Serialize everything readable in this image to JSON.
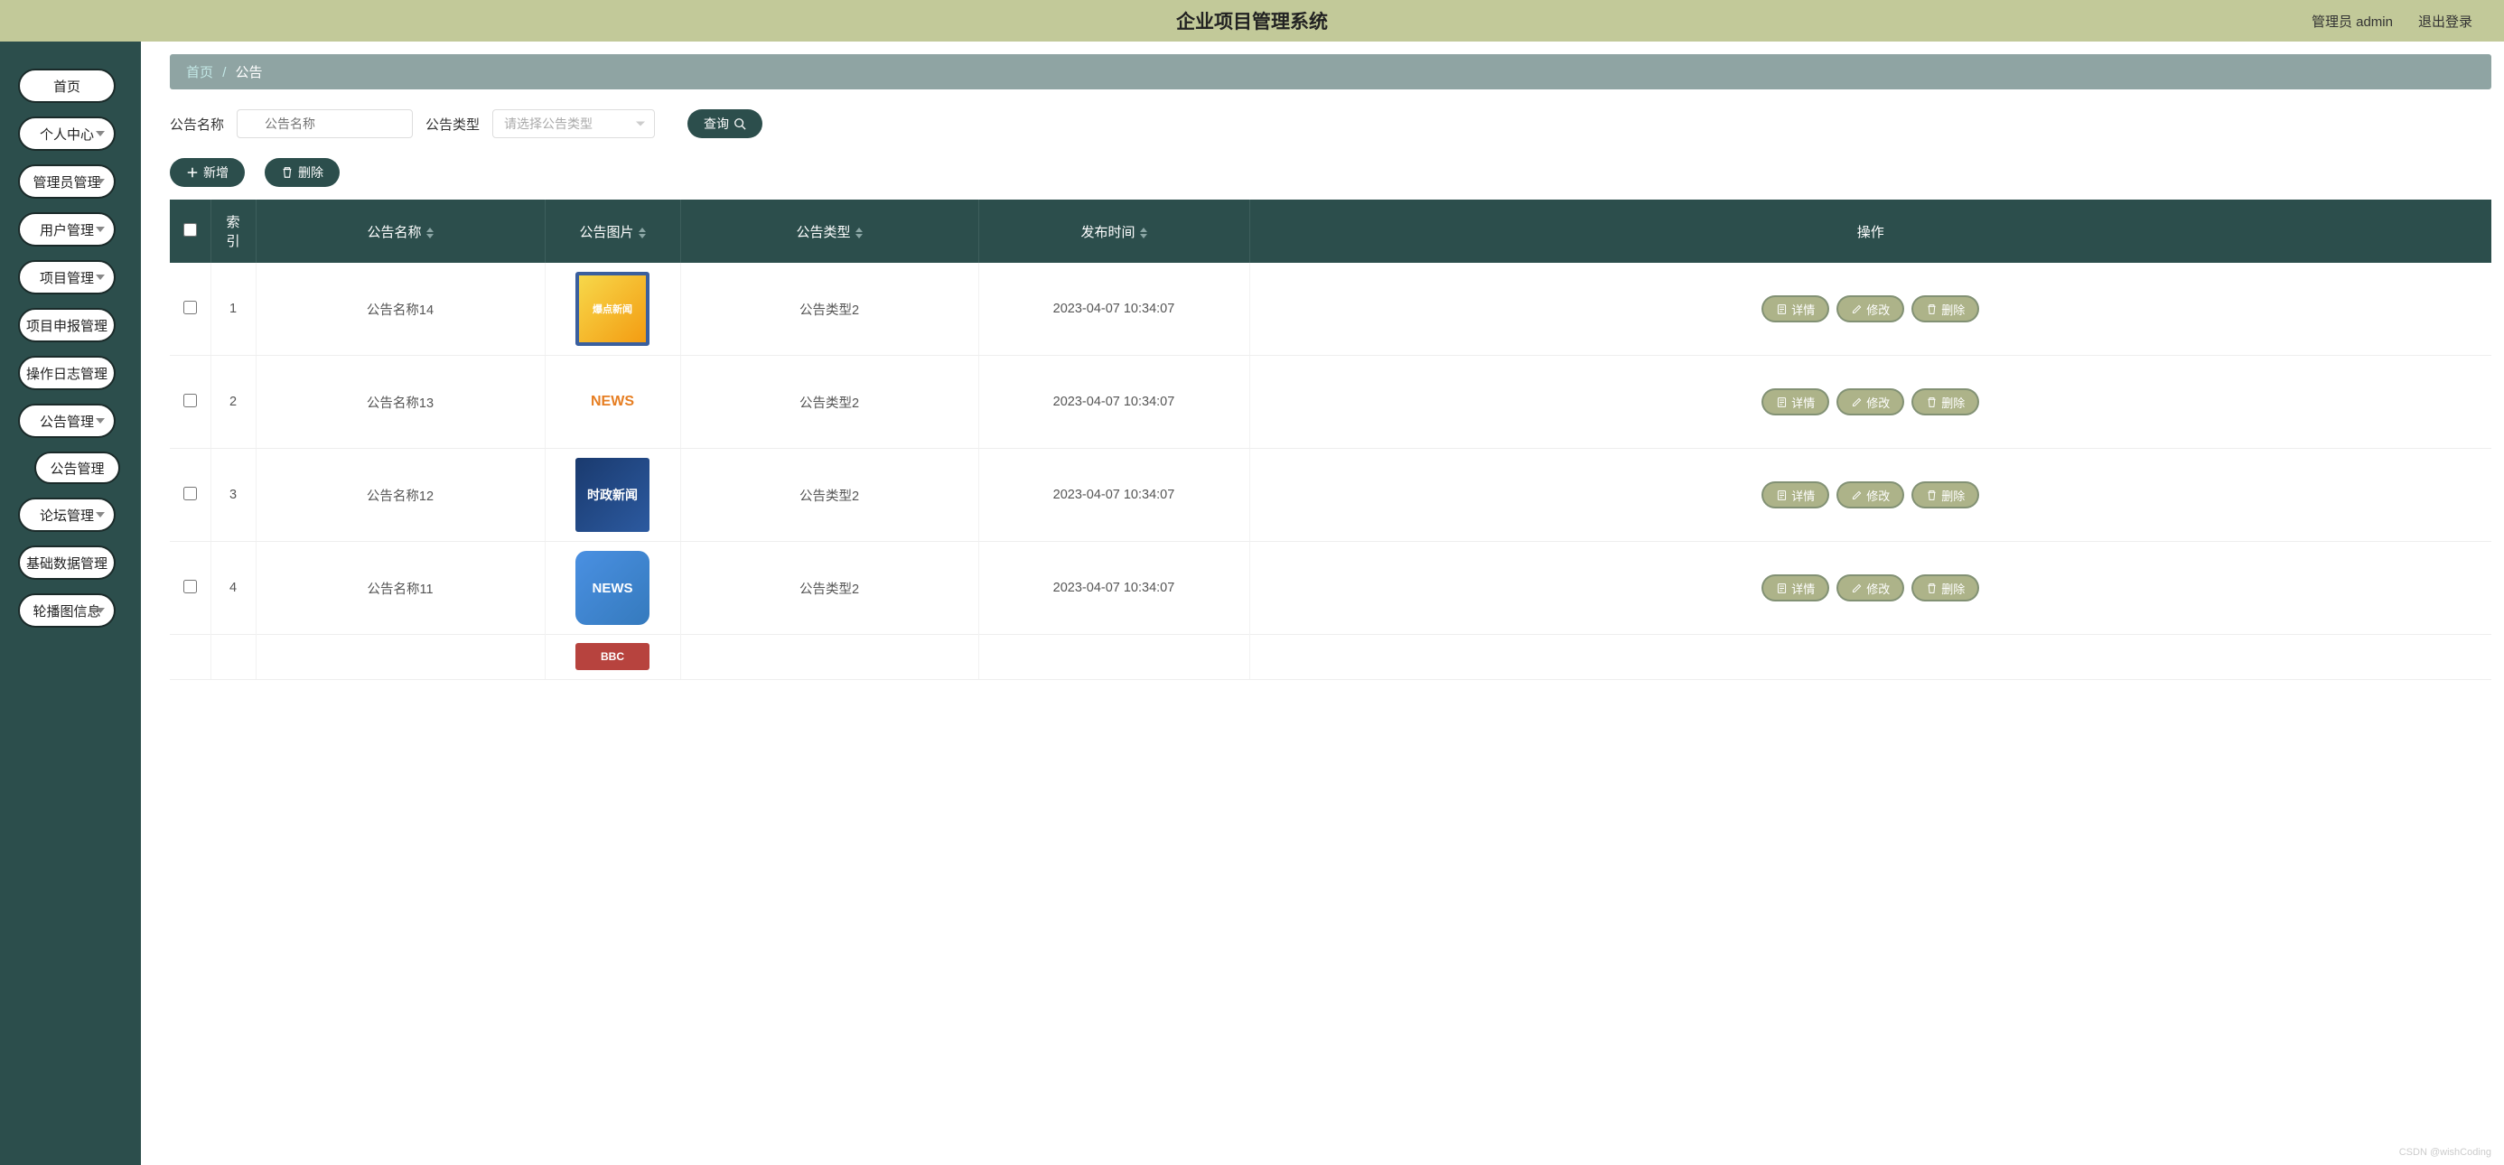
{
  "header": {
    "title": "企业项目管理系统",
    "user_label": "管理员 admin",
    "logout": "退出登录"
  },
  "sidebar": {
    "items": [
      {
        "label": "首页",
        "expandable": false
      },
      {
        "label": "个人中心",
        "expandable": true
      },
      {
        "label": "管理员管理",
        "expandable": true
      },
      {
        "label": "用户管理",
        "expandable": true
      },
      {
        "label": "项目管理",
        "expandable": true
      },
      {
        "label": "项目申报管理",
        "expandable": true
      },
      {
        "label": "操作日志管理",
        "expandable": true
      },
      {
        "label": "公告管理",
        "expandable": true,
        "open": true,
        "children": [
          {
            "label": "公告管理"
          }
        ]
      },
      {
        "label": "论坛管理",
        "expandable": true
      },
      {
        "label": "基础数据管理",
        "expandable": true
      },
      {
        "label": "轮播图信息",
        "expandable": true
      }
    ]
  },
  "breadcrumb": {
    "home": "首页",
    "current": "公告"
  },
  "filters": {
    "name_label": "公告名称",
    "name_placeholder": "公告名称",
    "type_label": "公告类型",
    "type_placeholder": "请选择公告类型",
    "search_btn": "查询"
  },
  "toolbar": {
    "add": "新增",
    "delete": "删除"
  },
  "table": {
    "headers": {
      "index": "索引",
      "name": "公告名称",
      "image": "公告图片",
      "type": "公告类型",
      "time": "发布时间",
      "actions": "操作"
    },
    "actions": {
      "detail": "详情",
      "edit": "修改",
      "del": "删除"
    },
    "rows": [
      {
        "idx": "1",
        "name": "公告名称14",
        "img": "爆点新闻",
        "type": "公告类型2",
        "time": "2023-04-07 10:34:07"
      },
      {
        "idx": "2",
        "name": "公告名称13",
        "img": "NEWS",
        "type": "公告类型2",
        "time": "2023-04-07 10:34:07"
      },
      {
        "idx": "3",
        "name": "公告名称12",
        "img": "时政新闻",
        "type": "公告类型2",
        "time": "2023-04-07 10:34:07"
      },
      {
        "idx": "4",
        "name": "公告名称11",
        "img": "NEWS",
        "type": "公告类型2",
        "time": "2023-04-07 10:34:07"
      }
    ]
  },
  "watermark": "CSDN @wishCoding"
}
